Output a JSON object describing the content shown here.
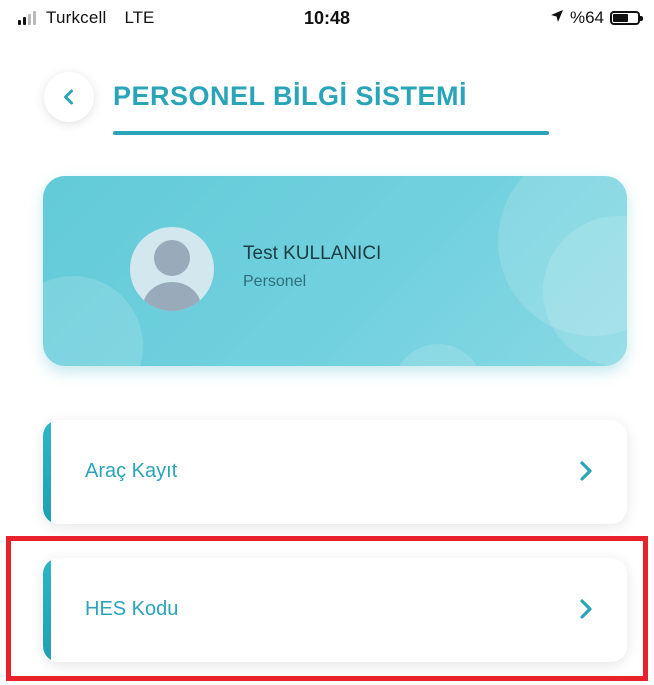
{
  "status_bar": {
    "carrier": "Turkcell",
    "network": "LTE",
    "time": "10:48",
    "battery_text": "%64",
    "battery_level": 0.64,
    "location_icon": "location-arrow-icon"
  },
  "header": {
    "title": "PERSONEL BİLGİ SİSTEMİ",
    "back_icon": "chevron-left-icon"
  },
  "profile": {
    "name": "Test KULLANICI",
    "role": "Personel",
    "avatar_icon": "user-avatar-icon"
  },
  "menu": {
    "items": [
      {
        "label": "Araç Kayıt",
        "icon": "chevron-right-icon"
      },
      {
        "label": "HES Kodu",
        "icon": "chevron-right-icon"
      }
    ]
  },
  "colors": {
    "accent": "#2aa4b8",
    "card_gradient_start": "#62cad8",
    "card_gradient_end": "#88d9e4",
    "highlight": "#e8212b"
  }
}
